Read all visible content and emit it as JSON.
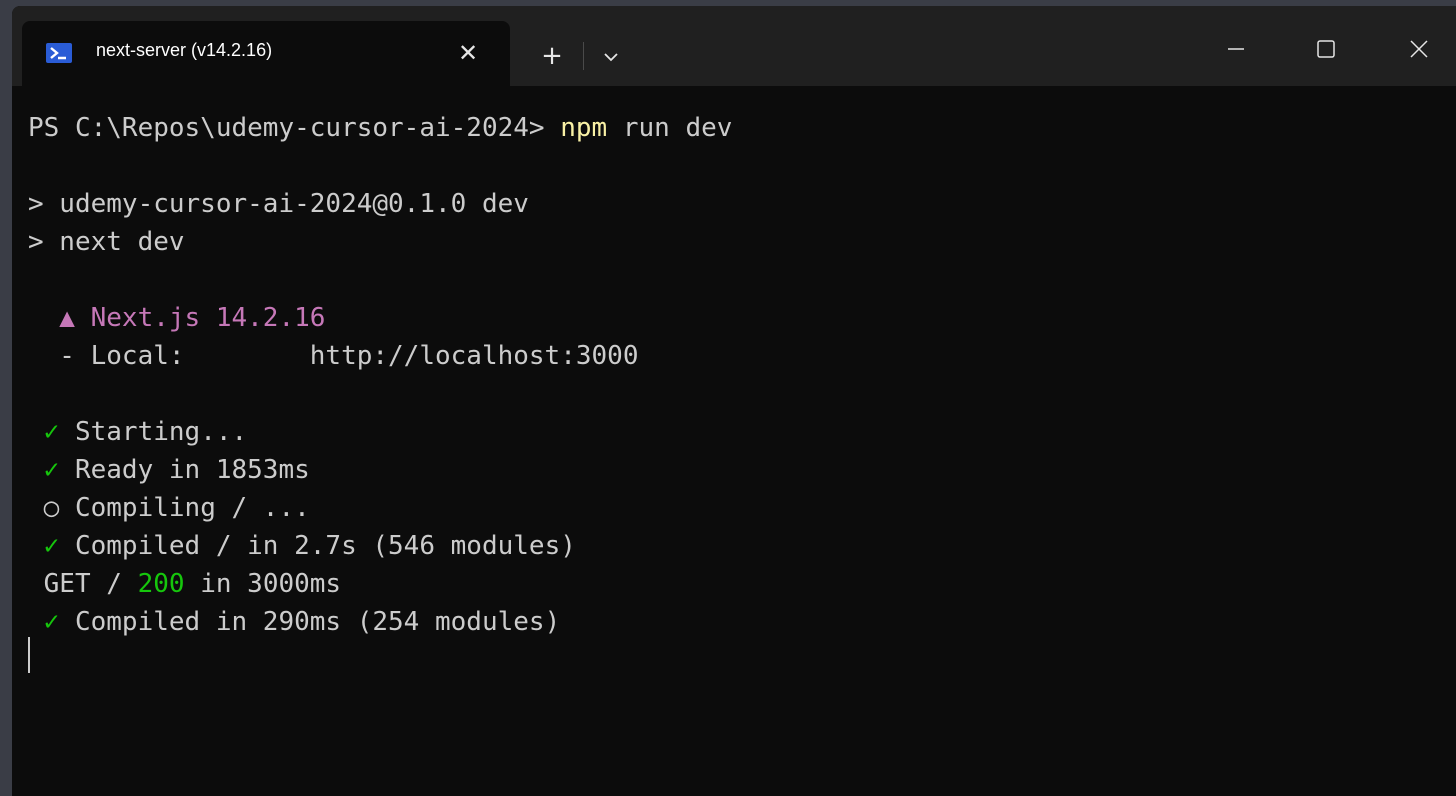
{
  "tab": {
    "title": "next-server (v14.2.16)",
    "icon": "powershell-icon",
    "close_icon": "close-icon"
  },
  "titlebar": {
    "new_tab_label": "+",
    "dropdown_icon": "chevron-down-icon",
    "minimize_icon": "minimize-icon",
    "maximize_icon": "maximize-icon",
    "close_icon": "close-icon"
  },
  "terminal": {
    "prompt": "PS C:\\Repos\\udemy-cursor-ai-2024> ",
    "command_name": "npm",
    "command_args": " run dev",
    "line_script": "> udemy-cursor-ai-2024@0.1.0 dev",
    "line_next": "> next dev",
    "nextjs_banner": "  ▲ Next.js 14.2.16",
    "local_line": "  - Local:        http://localhost:3000",
    "check_symbol": " ✓",
    "starting": " Starting...",
    "ready": " Ready in 1853ms",
    "compiling_symbol": " ○",
    "compiling": " Compiling / ...",
    "compiled_1": " Compiled / in 2.7s (546 modules)",
    "get_prefix": " GET / ",
    "get_status": "200",
    "get_suffix": " in 3000ms",
    "compiled_2": " Compiled in 290ms (254 modules)"
  },
  "colors": {
    "background": "#0c0c0c",
    "titlebar": "#202020",
    "command_yellow": "#f9f1a5",
    "nextjs_magenta": "#c678b8",
    "success_green": "#16c60c",
    "text": "#cccccc"
  }
}
